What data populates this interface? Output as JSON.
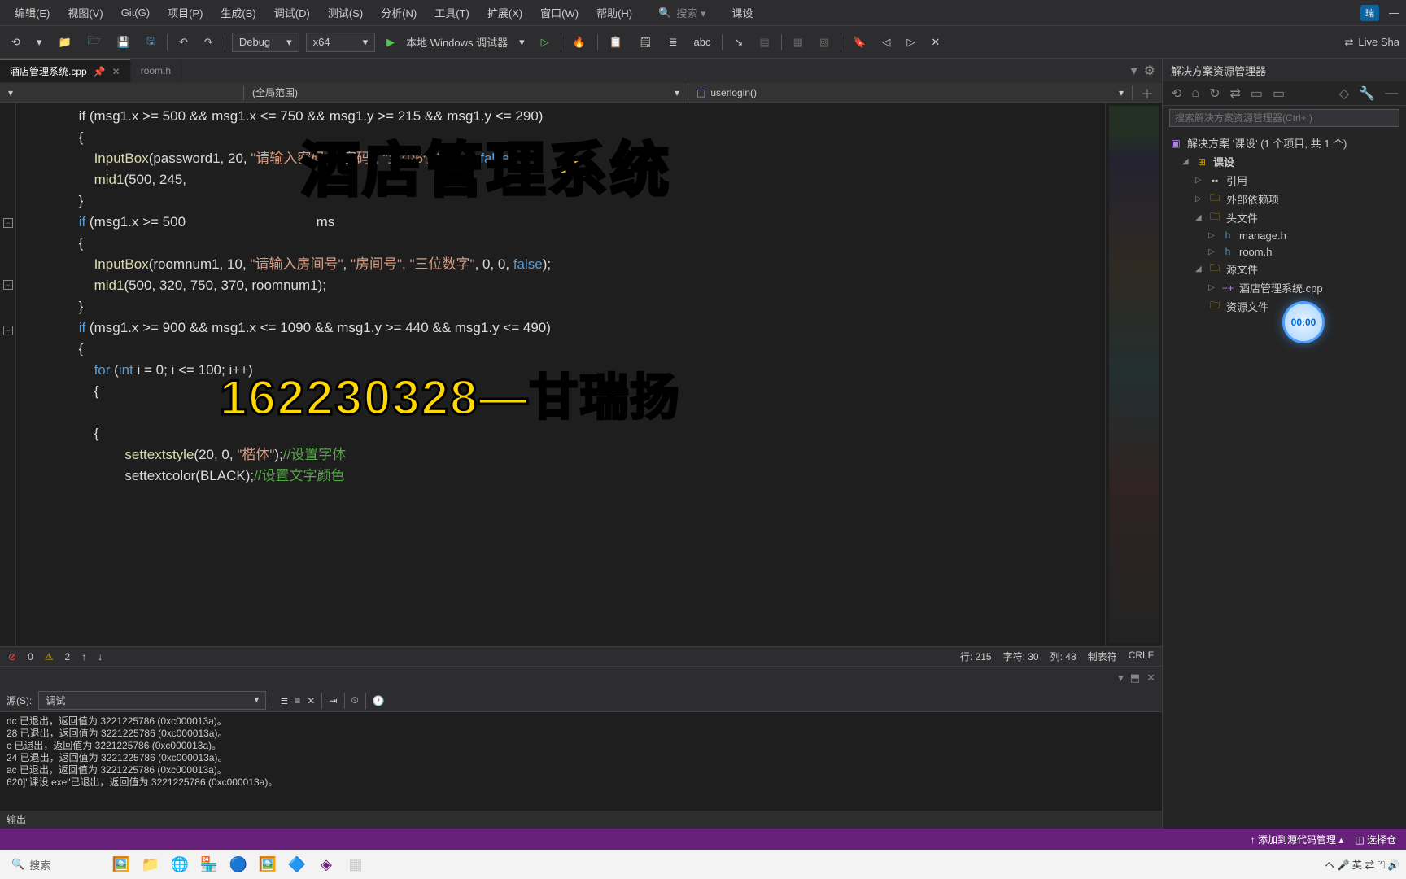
{
  "menubar": {
    "items": [
      "编辑(E)",
      "视图(V)",
      "Git(G)",
      "项目(P)",
      "生成(B)",
      "调试(D)",
      "测试(S)",
      "分析(N)",
      "工具(T)",
      "扩展(X)",
      "窗口(W)",
      "帮助(H)"
    ],
    "search_label": "搜索 ▾",
    "title": "课设",
    "badge": "瑞",
    "minimize": "—"
  },
  "toolbar": {
    "config": "Debug",
    "platform": "x64",
    "debugger": "本地 Windows 调试器",
    "liveshare": "Live Sha"
  },
  "tabs": {
    "active": "酒店管理系统.cpp",
    "inactive": "room.h"
  },
  "breadcrumb": {
    "scope": "(全局范围)",
    "function": "userlogin()"
  },
  "code": {
    "l1": "            if (msg1.x >= 500 && msg1.x <= 750 && msg1.y >= 215 && msg1.y <= 290)",
    "l2": "            {",
    "l3_a": "                ",
    "l3_fn": "InputBox",
    "l3_b": "(password1, 20, ",
    "l3_s1": "\"请输入密码\"",
    "l3_c": ", ",
    "l3_s2": "\"密码\"",
    "l3_d": ", ",
    "l3_s3": "\"至少6位\"",
    "l3_e": ", 0, 0, ",
    "l3_kw": "false",
    "l3_f": ");",
    "l4_a": "                ",
    "l4_fn": "mid1",
    "l4_b": "(500, 245,",
    "l5": "            }",
    "l6_a": "            ",
    "l6_kw": "if",
    "l6_b": " (msg1.x >= 500",
    "l6_c": "                                  ms",
    "l7": "            {",
    "l8_a": "                ",
    "l8_fn": "InputBox",
    "l8_b": "(roomnum1, 10, ",
    "l8_s1": "\"请输入房间号\"",
    "l8_c": ", ",
    "l8_s2": "\"房间号\"",
    "l8_d": ", ",
    "l8_s3": "\"三位数字\"",
    "l8_e": ", 0, 0, ",
    "l8_kw": "false",
    "l8_f": ");",
    "l9_a": "                ",
    "l9_fn": "mid1",
    "l9_b": "(500, 320, 750, 370, roomnum1);",
    "l10": "            }",
    "l11_a": "            ",
    "l11_kw": "if",
    "l11_b": " (msg1.x >= 900 && msg1.x <= 1090 && msg1.y >= 440 && msg1.y <= 490)",
    "l12": "            {",
    "l13_a": "                ",
    "l13_kw": "for",
    "l13_b": " (",
    "l13_kw2": "int",
    "l13_c": " i = 0; i <= 100; i++)",
    "l14": "                {",
    "l15": "",
    "l16": "                {",
    "l17_a": "                        ",
    "l17_fn": "settextstyle",
    "l17_b": "(20, 0, ",
    "l17_s": "\"楷体\"",
    "l17_c": ");",
    "l17_cmt": "//设置字体",
    "l18_a": "                        settextcolor(BLACK);",
    "l18_cmt": "//设置文字颜色"
  },
  "status": {
    "errors": "0",
    "warnings": "2",
    "line": "行: 215",
    "char": "字符: 30",
    "col": "列: 48",
    "tabs": "制表符",
    "crlf": "CRLF"
  },
  "output": {
    "source_label": "源(S):",
    "source_value": "调试",
    "lines": [
      "dc 已退出，返回值为 3221225786 (0xc000013a)。",
      "28 已退出，返回值为 3221225786 (0xc000013a)。",
      "c 已退出，返回值为 3221225786 (0xc000013a)。",
      "24 已退出，返回值为 3221225786 (0xc000013a)。",
      "ac 已退出，返回值为 3221225786 (0xc000013a)。",
      "620]\"课设.exe\"已退出，返回值为 3221225786 (0xc000013a)。"
    ],
    "footer": "输出"
  },
  "solution": {
    "title": "解决方案资源管理器",
    "search_placeholder": "搜索解决方案资源管理器(Ctrl+;)",
    "root": "解决方案 '课设' (1 个项目, 共 1 个)",
    "project": "课设",
    "refs": "引用",
    "external": "外部依赖项",
    "headers": "头文件",
    "h1": "manage.h",
    "h2": "room.h",
    "sources": "源文件",
    "cpp": "酒店管理系统.cpp",
    "resources": "资源文件"
  },
  "bottombar": {
    "add_source": "↑ 添加到源代码管理 ▴",
    "select": "◫ 选择仓"
  },
  "taskbar": {
    "search": "搜索",
    "tray": "ヘ 🎤 英 ⇄ ⏍ 🔊"
  },
  "overlay": {
    "title": "酒店管理系统",
    "sub": "162230328—甘瑞扬",
    "timer": "00:00"
  }
}
